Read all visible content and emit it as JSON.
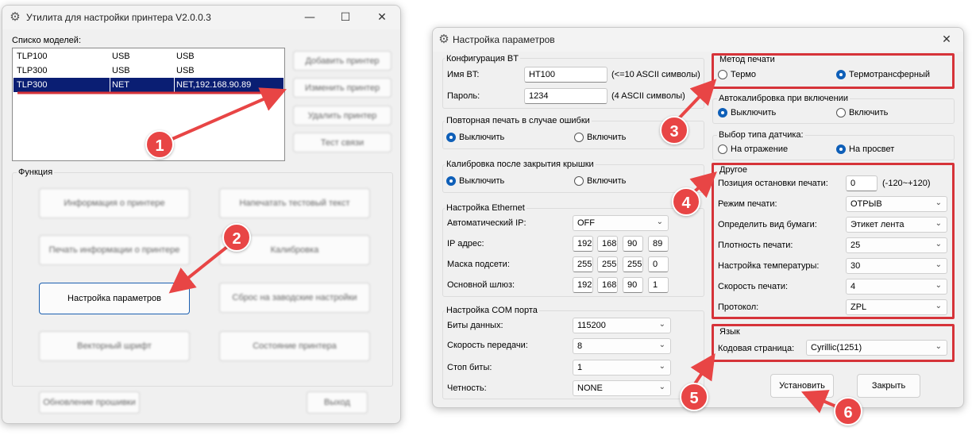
{
  "left_window": {
    "title": "Утилита для настройки принтера  V2.0.0.3",
    "minimize": "—",
    "maximize": "☐",
    "close": "✕",
    "models_label": "Списко моделей:",
    "models": [
      {
        "name": "TLP100",
        "port": "USB",
        "address": "USB"
      },
      {
        "name": "TLP300",
        "port": "USB",
        "address": "USB"
      },
      {
        "name": "TLP300",
        "port": "NET",
        "address": "NET,192.168.90.89"
      }
    ],
    "side_buttons": [
      "Добавить принтер",
      "Изменить принтер",
      "Удалить принтер",
      "Тест связи"
    ],
    "function_label": "Функция",
    "function_buttons": [
      "Информация о принтере",
      "Напечатать тестовый текст",
      "Печать информации о принтере",
      "Калибровка",
      "Настройка параметров",
      "Сброс на заводские настройки",
      "Векторный шрифт",
      "Состояние принтера"
    ],
    "update_button": "Обновление прошивки",
    "exit_button": "Выход"
  },
  "right_window": {
    "title": "Настройка параметров",
    "close": "✕",
    "bt": {
      "label": "Конфигурация BT",
      "name_label": "Имя BT:",
      "name_value": "HT100",
      "name_hint": "(<=10 ASCII символы)",
      "pass_label": "Пароль:",
      "pass_value": "1234",
      "pass_hint": "(4 ASCII символы)"
    },
    "reprint": {
      "label": "Повторная печать в случае ошибки",
      "off": "Выключить",
      "on": "Включить"
    },
    "lid_calib": {
      "label": "Калибровка после закрытия крышки",
      "off": "Выключить",
      "on": "Включить"
    },
    "ethernet": {
      "label": "Настройка Ethernet",
      "auto_ip_label": "Автоматический IP:",
      "auto_ip_value": "OFF",
      "ip_label": "IP адрес:",
      "ip": [
        "192",
        "168",
        "90",
        "89"
      ],
      "mask_label": "Маска подсети:",
      "mask": [
        "255",
        "255",
        "255",
        "0"
      ],
      "gw_label": "Основной шлюз:",
      "gw": [
        "192",
        "168",
        "90",
        "1"
      ]
    },
    "com": {
      "label": "Настройка COM порта",
      "data_bits_label": "Биты данных:",
      "data_bits_value": "115200",
      "baud_label": "Скорость передачи:",
      "baud_value": "8",
      "stop_label": "Стоп биты:",
      "stop_value": "1",
      "parity_label": "Четность:",
      "parity_value": "NONE"
    },
    "print_method": {
      "label": "Метод печати",
      "thermo": "Термо",
      "transfer": "Термотрансферный"
    },
    "autocalib": {
      "label": "Автокалибровка при включении",
      "off": "Выключить",
      "on": "Включить"
    },
    "sensor": {
      "label": "Выбор типа датчика:",
      "reflect": "На отражение",
      "through": "На просвет"
    },
    "other": {
      "label": "Другое",
      "stop_pos_label": "Позиция остановки печати:",
      "stop_pos_value": "0",
      "stop_pos_hint": "(-120~+120)",
      "mode_label": "Режим печати:",
      "mode_value": "ОТРЫВ",
      "paper_label": "Определить вид бумаги:",
      "paper_value": "Этикет лента",
      "density_label": "Плотность печати:",
      "density_value": "25",
      "temp_label": "Настройка температуры:",
      "temp_value": "30",
      "speed_label": "Скорость печати:",
      "speed_value": "4",
      "protocol_label": "Протокол:",
      "protocol_value": "ZPL"
    },
    "language": {
      "label": "Язык",
      "codepage_label": "Кодовая страница:",
      "codepage_value": "Cyrillic(1251)"
    },
    "install_button": "Установить",
    "close_button": "Закрыть"
  },
  "annotations": [
    "1",
    "2",
    "3",
    "4",
    "5",
    "6"
  ],
  "colors": {
    "accent_red": "#d63339",
    "badge_red": "#e84545",
    "selection_navy": "#0a1e73",
    "radio_blue": "#0e5fb8"
  }
}
